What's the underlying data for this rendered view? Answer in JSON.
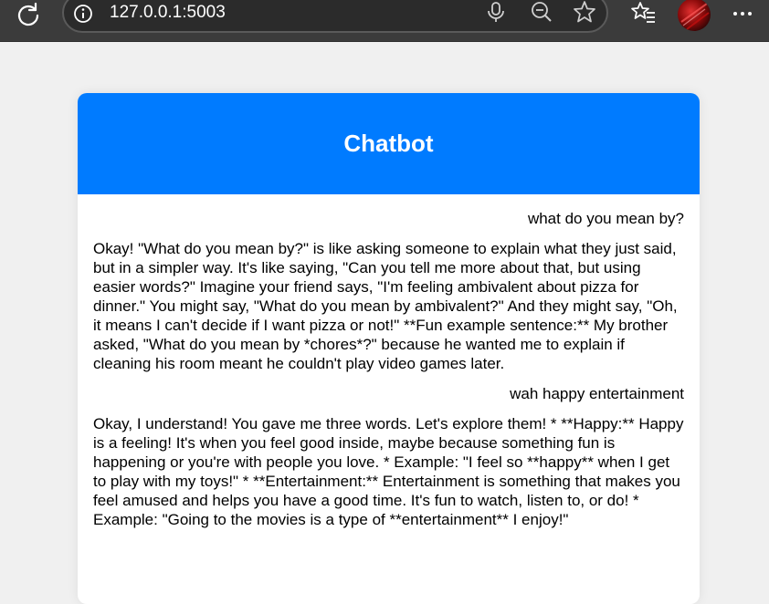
{
  "browser": {
    "url": "127.0.0.1:5003",
    "icons": [
      "reload-icon",
      "info-icon",
      "microphone-icon",
      "zoom-out-icon",
      "favorite-star-icon",
      "favorites-list-icon",
      "avatar",
      "more-icon"
    ]
  },
  "chat": {
    "title": "Chatbot",
    "header_color": "#007bff",
    "messages": [
      {
        "role": "user",
        "text": "what do you mean by?"
      },
      {
        "role": "bot",
        "text": "Okay! \"What do you mean by?\" is like asking someone to explain what they just said, but in a simpler way. It's like saying, \"Can you tell me more about that, but using easier words?\" Imagine your friend says, \"I'm feeling ambivalent about pizza for dinner.\" You might say, \"What do you mean by ambivalent?\" And they might say, \"Oh, it means I can't decide if I want pizza or not!\" **Fun example sentence:** My brother asked, \"What do you mean by *chores*?\" because he wanted me to explain if cleaning his room meant he couldn't play video games later."
      },
      {
        "role": "user",
        "text": "wah happy entertainment"
      },
      {
        "role": "bot",
        "text": "Okay, I understand! You gave me three words. Let's explore them! * **Happy:** Happy is a feeling! It's when you feel good inside, maybe because something fun is happening or you're with people you love. * Example: \"I feel so **happy** when I get to play with my toys!\" * **Entertainment:** Entertainment is something that makes you feel amused and helps you have a good time. It's fun to watch, listen to, or do! * Example: \"Going to the movies is a type of **entertainment** I enjoy!\""
      }
    ]
  }
}
